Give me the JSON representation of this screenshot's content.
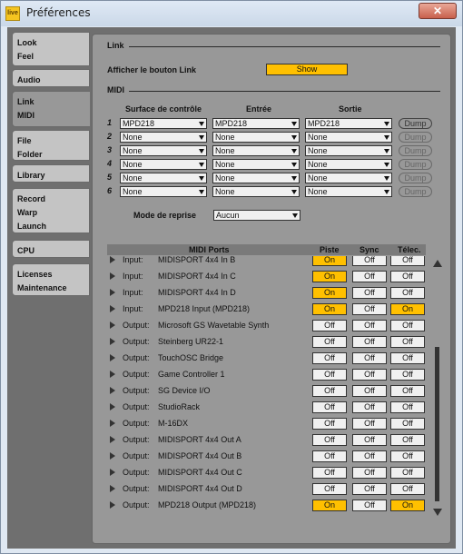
{
  "window": {
    "title": "Préférences",
    "app_icon_text": "live",
    "close_symbol": "✕"
  },
  "sidebar": {
    "tabs": [
      {
        "label": "Look\nFeel",
        "active": false
      },
      {
        "label": "Audio",
        "active": false
      },
      {
        "label": "Link\nMIDI",
        "active": true
      },
      {
        "label": "File\nFolder",
        "active": false
      },
      {
        "label": "Library",
        "active": false
      },
      {
        "label": "Record\nWarp\nLaunch",
        "active": false
      },
      {
        "label": "CPU",
        "active": false
      },
      {
        "label": "Licenses\nMaintenance",
        "active": false
      }
    ]
  },
  "link": {
    "section_title": "Link",
    "show_label": "Afficher le bouton Link",
    "show_button": "Show"
  },
  "midi": {
    "section_title": "MIDI",
    "col_surface": "Surface de contrôle",
    "col_input": "Entrée",
    "col_output": "Sortie",
    "rows": [
      {
        "num": "1",
        "surface": "MPD218",
        "input": "MPD218",
        "output": "MPD218",
        "dump": "Dump",
        "dump_enabled": true
      },
      {
        "num": "2",
        "surface": "None",
        "input": "None",
        "output": "None",
        "dump": "Dump",
        "dump_enabled": false
      },
      {
        "num": "3",
        "surface": "None",
        "input": "None",
        "output": "None",
        "dump": "Dump",
        "dump_enabled": false
      },
      {
        "num": "4",
        "surface": "None",
        "input": "None",
        "output": "None",
        "dump": "Dump",
        "dump_enabled": false
      },
      {
        "num": "5",
        "surface": "None",
        "input": "None",
        "output": "None",
        "dump": "Dump",
        "dump_enabled": false
      },
      {
        "num": "6",
        "surface": "None",
        "input": "None",
        "output": "None",
        "dump": "Dump",
        "dump_enabled": false
      }
    ],
    "mode_label": "Mode de reprise",
    "mode_value": "Aucun"
  },
  "ports": {
    "headers": {
      "name": "MIDI Ports",
      "track": "Piste",
      "sync": "Sync",
      "remote": "Télec."
    },
    "rows": [
      {
        "kind": "Input:",
        "name": "MIDISPORT 4x4 In B",
        "track": "On",
        "sync": "Off",
        "remote": "Off"
      },
      {
        "kind": "Input:",
        "name": "MIDISPORT 4x4 In C",
        "track": "On",
        "sync": "Off",
        "remote": "Off"
      },
      {
        "kind": "Input:",
        "name": "MIDISPORT 4x4 In D",
        "track": "On",
        "sync": "Off",
        "remote": "Off"
      },
      {
        "kind": "Input:",
        "name": "MPD218 Input (MPD218)",
        "track": "On",
        "sync": "Off",
        "remote": "On"
      },
      {
        "kind": "Output:",
        "name": "Microsoft GS Wavetable Synth",
        "track": "Off",
        "sync": "Off",
        "remote": "Off"
      },
      {
        "kind": "Output:",
        "name": "Steinberg UR22-1",
        "track": "Off",
        "sync": "Off",
        "remote": "Off"
      },
      {
        "kind": "Output:",
        "name": "TouchOSC Bridge",
        "track": "Off",
        "sync": "Off",
        "remote": "Off"
      },
      {
        "kind": "Output:",
        "name": "Game Controller 1",
        "track": "Off",
        "sync": "Off",
        "remote": "Off"
      },
      {
        "kind": "Output:",
        "name": "SG Device I/O",
        "track": "Off",
        "sync": "Off",
        "remote": "Off"
      },
      {
        "kind": "Output:",
        "name": "StudioRack",
        "track": "Off",
        "sync": "Off",
        "remote": "Off"
      },
      {
        "kind": "Output:",
        "name": "M-16DX",
        "track": "Off",
        "sync": "Off",
        "remote": "Off"
      },
      {
        "kind": "Output:",
        "name": "MIDISPORT 4x4 Out A",
        "track": "Off",
        "sync": "Off",
        "remote": "Off"
      },
      {
        "kind": "Output:",
        "name": "MIDISPORT 4x4 Out B",
        "track": "Off",
        "sync": "Off",
        "remote": "Off"
      },
      {
        "kind": "Output:",
        "name": "MIDISPORT 4x4 Out C",
        "track": "Off",
        "sync": "Off",
        "remote": "Off"
      },
      {
        "kind": "Output:",
        "name": "MIDISPORT 4x4 Out D",
        "track": "Off",
        "sync": "Off",
        "remote": "Off"
      },
      {
        "kind": "Output:",
        "name": "MPD218 Output (MPD218)",
        "track": "On",
        "sync": "Off",
        "remote": "On"
      }
    ]
  },
  "colors": {
    "toggle_on": "#ffc000",
    "toggle_off": "#f0f0f0",
    "panel": "#989898",
    "client_bg": "#6f6f6f"
  }
}
